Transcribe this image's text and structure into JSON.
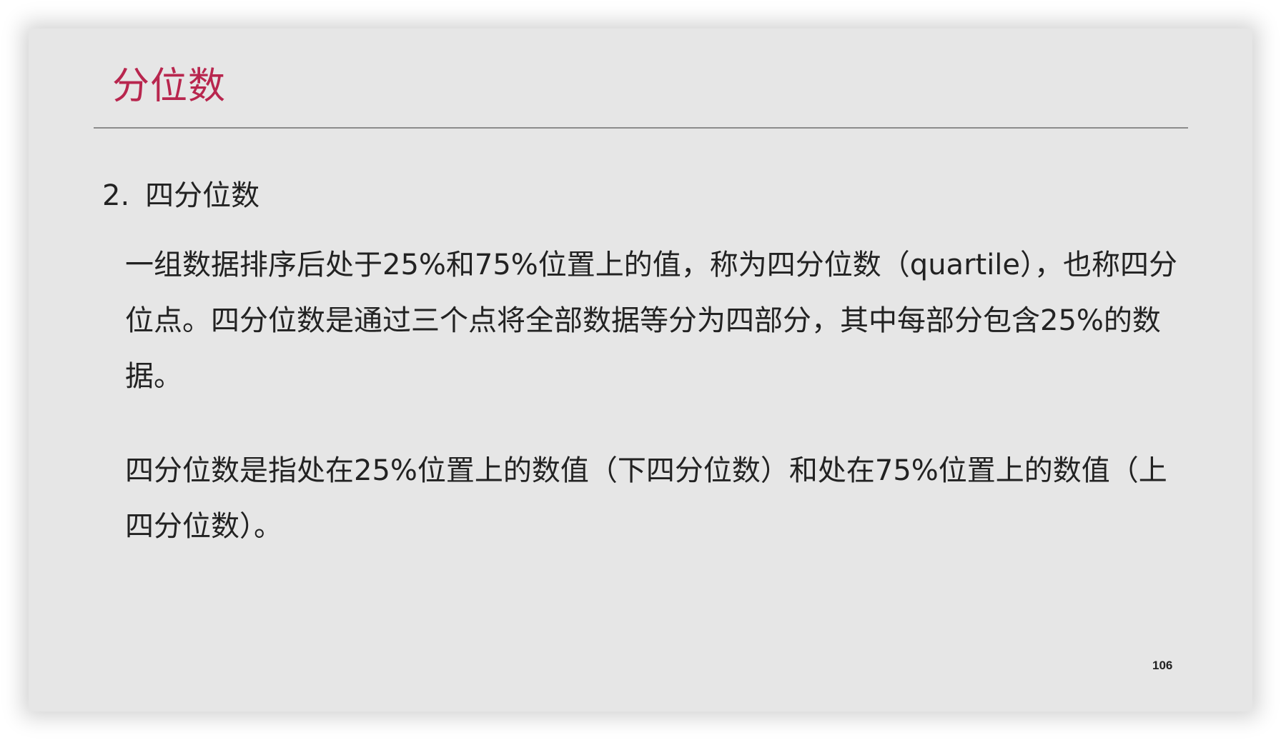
{
  "slide": {
    "title": "分位数",
    "section": {
      "number": "2.",
      "heading": "四分位数"
    },
    "paragraphs": [
      "一组数据排序后处于25%和75%位置上的值，称为四分位数（quartile），也称四分位点。四分位数是通过三个点将全部数据等分为四部分，其中每部分包含25%的数据。",
      "四分位数是指处在25%位置上的数值（下四分位数）和处在75%位置上的数值（上四分位数）。"
    ],
    "page_number": "106"
  },
  "colors": {
    "title": "#b8264e",
    "slide_background": "#e6e6e6",
    "body_text": "#222222",
    "rule": "#8c8c8c"
  }
}
